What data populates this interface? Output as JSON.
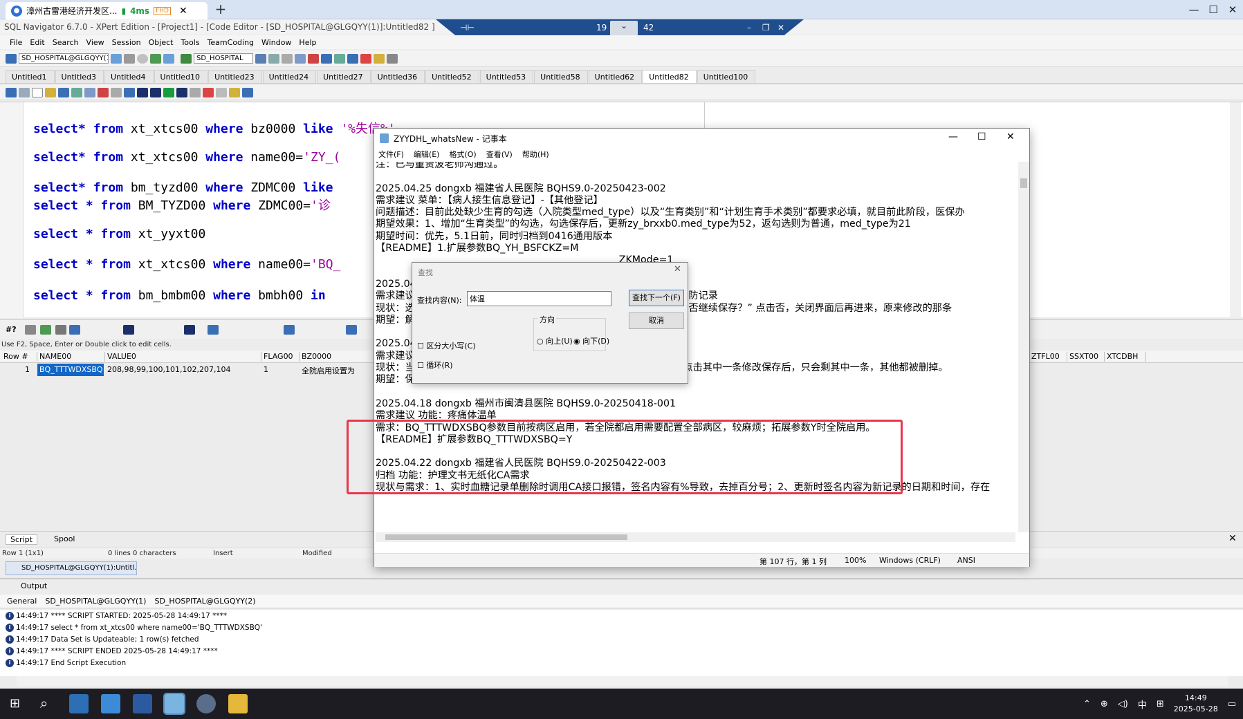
{
  "browser": {
    "tab_title": "漳州古雷港经济开发区...",
    "ping": "4ms",
    "quality": "FHD",
    "remote_label": "19",
    "remote_label2": "42"
  },
  "app": {
    "title": "SQL Navigator 6.7.0 - XPert Edition - [Project1] - [Code Editor - [SD_HOSPITAL@GLGQYY(1)]:Untitled82 ]",
    "menu": [
      "File",
      "Edit",
      "Search",
      "View",
      "Session",
      "Object",
      "Tools",
      "TeamCoding",
      "Window",
      "Help"
    ],
    "connection": "SD_HOSPITAL@GLGQYY(1)",
    "schema": "SD_HOSPITAL"
  },
  "editor_tabs": [
    "Untitled1",
    "Untitled3",
    "Untitled4",
    "Untitled10",
    "Untitled23",
    "Untitled24",
    "Untitled27",
    "Untitled36",
    "Untitled52",
    "Untitled53",
    "Untitled58",
    "Untitled62",
    "Untitled82",
    "Untitled100"
  ],
  "active_tab": "Untitled82",
  "code": {
    "l1": [
      "select*",
      " from",
      " xt_xtcs00",
      " where",
      " bz0000",
      " like",
      " '%失信%'"
    ],
    "l2": [
      "select*",
      " from",
      " xt_xtcs00",
      " where",
      " name00=",
      "'ZY_("
    ],
    "l3": [
      "select*",
      " from",
      " bm_tyzd00",
      " where",
      " ZDMC00",
      " like"
    ],
    "l4": [
      "select",
      " *",
      " from",
      " BM_TYZD00",
      " where",
      " ZDMC00=",
      "'诊 "
    ],
    "l5": [
      "select",
      " *",
      " from",
      " xt_yyxt00"
    ],
    "l6": [
      "select",
      " *",
      " from",
      " xt_xtcs00",
      " where",
      " name00=",
      "'BQ_"
    ],
    "l7": [
      "select",
      " *",
      " from",
      " bm_bmbm00",
      " where",
      " bmbh00",
      " in"
    ]
  },
  "grid": {
    "hint": "Use F2, Space, Enter or Double click to edit cells.",
    "headers": [
      "Row #",
      "NAME00",
      "VALUE0",
      "FLAG00",
      "BZ0000",
      "ZTFL00",
      "SSXT00",
      "XTCDBH"
    ],
    "row": {
      "num": "1",
      "name": "BQ_TTTWDXSBQ",
      "value": "208,98,99,100,101,102,207,104",
      "flag": "1",
      "bz": "全院启用设置为"
    },
    "tb_label": "#?"
  },
  "script_tabs": [
    "Script",
    "Spool"
  ],
  "status": {
    "pos": "Row 1 (1x1)",
    "lines": "0 lines 0 characters",
    "mode": "Insert",
    "modified": "Modified"
  },
  "conn_tab": "SD_HOSPITAL@GLGQYY(1):Untitl...",
  "output": {
    "title": "Output",
    "tabs": [
      "General",
      "SD_HOSPITAL@GLGQYY(1)",
      "SD_HOSPITAL@GLGQYY(2)"
    ],
    "log": [
      "14:49:17  **** SCRIPT STARTED: 2025-05-28 14:49:17 ****",
      "14:49:17  select * from xt_xtcs00 where name00='BQ_TTTWDXSBQ'",
      "14:49:17  Data Set is Updateable; 1 row(s) fetched",
      "14:49:17  **** SCRIPT ENDED 2025-05-28 14:49:17 ****",
      "14:49:17  End Script Execution"
    ]
  },
  "notepad": {
    "title": "ZYYDHL_whatsNew - 记事本",
    "menu": [
      "文件(F)",
      "编辑(E)",
      "格式(O)",
      "查看(V)",
      "帮助(H)"
    ],
    "lines": [
      "注：已与董贤波老师沟通过。",
      "",
      "2025.04.25 dongxb 福建省人民医院 BQHS9.0-20250423-002",
      "需求建议 菜单：【病人接生信息登记】-【其他登记】",
      "问题描述：目前此处缺少生育的勾选（入院类型med_type）以及“生育类别”和“计划生育手术类别”都要求必填，就目前此阶段，医保办\u0005",
      "期望效果：1、增加“生育类型”的勾选，勾选保存后，更新zy_brxxb0.med_type为52，返勾选则为普通，med_type为21",
      "期望时间：优先，5.1日前，同时归档到0416通用版本",
      "【README】1.扩展参数BQ_YH_BSFCKZ=M",
      "                                                                              ZKMode=1",
      "",
      "2025.04",
      "需求建议                                                                        险评估和预防记录",
      "现状：选                                                                        未填项，是否继续保存？” 点击否，关闭界面后再进来，原来修改的那条",
      "期望：解",
      "",
      "2025.04",
      "需求建议 菜单：住院病人-实时血糖记录单",
      "现状：当前可录入多天同一时间点血糖记录，如 2025-04-24 13:51；点击其中一条修改保存后，只会剩其中一条，其他都被删掉。",
      "期望：保存时校验同一时间点只能录入一条数据",
      "",
      "2025.04.18 dongxb 福州市闽清县医院 BQHS9.0-20250418-001",
      "需求建议 功能：疼痛体温单",
      "需求：BQ_TTTWDXSBQ参数目前按病区启用，若全院都启用需要配置全部病区，较麻烦；拓展参数Y时全院启用。",
      "【README】扩展参数BQ_TTTWDXSBQ=Y",
      "",
      "2025.04.22 dongxb 福建省人民医院 BQHS9.0-20250422-003",
      "归档 功能：护理文书无纸化CA需求",
      "现状与需求：1、实时血糖记录单删除时调用CA接口报错，签名内容有%导致，去掉百分号；2、更新时签名内容为新记录的日期和时间，存在"
    ],
    "status": {
      "pos": "第 107 行，第 1 列",
      "zoom": "100%",
      "eol": "Windows (CRLF)",
      "enc": "ANSI"
    }
  },
  "find": {
    "title": "查找",
    "label": "查找内容(N):",
    "value": "体温",
    "find_next": "查找下一个(F)",
    "cancel": "取消",
    "direction": "方向",
    "up": "向上(U)",
    "down": "向下(D)",
    "case": "区分大小写(C)",
    "wrap": "循环(R)"
  },
  "clock": {
    "time": "14:49",
    "date": "2025-05-28"
  },
  "tray_ime": "中"
}
